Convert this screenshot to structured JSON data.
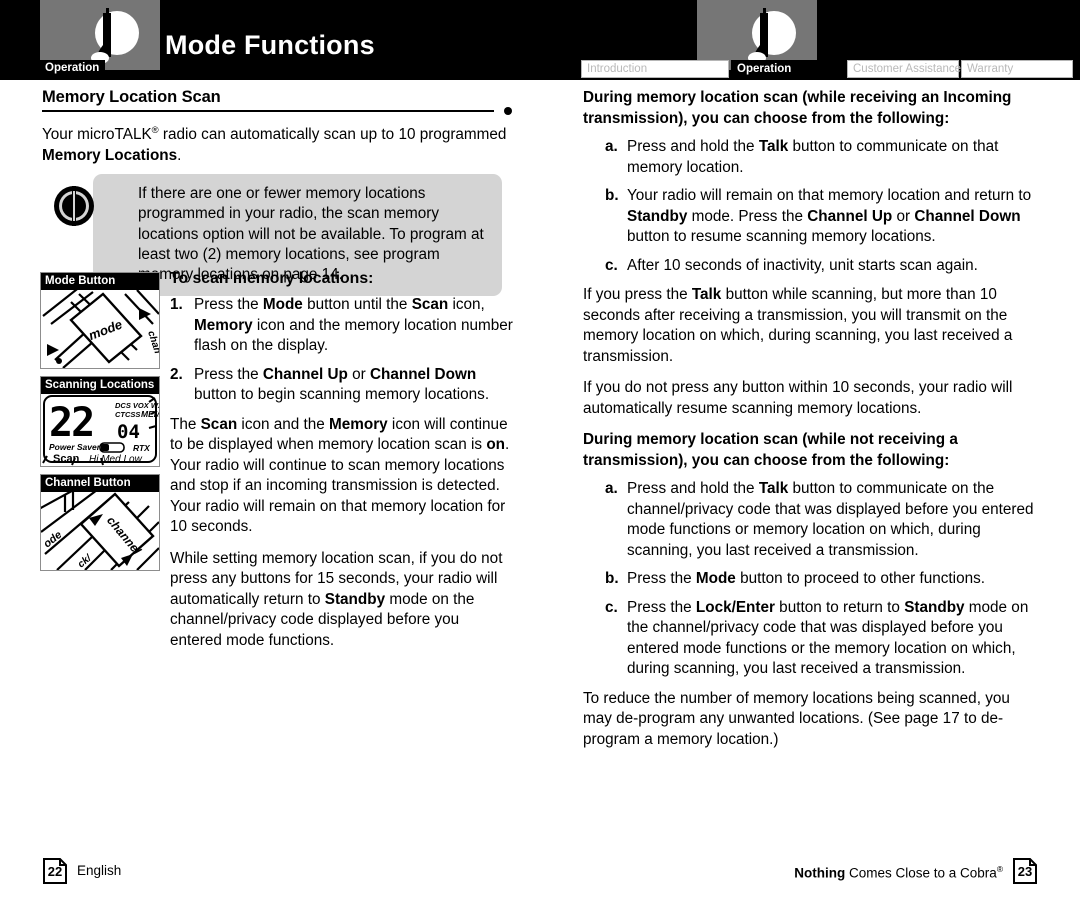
{
  "header": {
    "title": "Mode Functions",
    "operation_tag": "Operation",
    "logo_icon": "cobra-radio-logo-icon",
    "tabs": [
      {
        "label": "Introduction",
        "active": false
      },
      {
        "label": "Operation",
        "active": true
      },
      {
        "label": "Customer Assistance",
        "active": false
      },
      {
        "label": "Warranty",
        "active": false
      }
    ]
  },
  "left_page": {
    "section_heading": "Memory Location Scan",
    "intro_p1_a": "Your microTALK",
    "intro_p1_sup": "®",
    "intro_p1_b": " radio can automatically scan up to 10 programmed ",
    "intro_p1_bold": "Memory Locations",
    "intro_p1_c": ".",
    "note": {
      "icon": "info-circle-icon",
      "text": "If there are one or fewer memory locations programmed in your radio, the scan memory locations option will not be available. To program at least two (2) memory locations, see program memory locations on page 14."
    },
    "figures": [
      {
        "caption": "Mode Button",
        "art": "radio-mode-button-photo"
      },
      {
        "caption": "Scanning Locations",
        "art": "lcd-scanning-locations-photo"
      },
      {
        "caption": "Channel Button",
        "art": "radio-channel-button-photo"
      }
    ],
    "lcd": {
      "channel": "22",
      "memory": "04",
      "indicators": [
        "DCS",
        "VOX",
        "WX",
        "CTCSS",
        "MEM",
        "Power Saver",
        "RTX",
        "Scan",
        "Hi",
        "Med",
        "Low"
      ]
    },
    "sub_heading": "To scan memory locations:",
    "steps": [
      {
        "marker": "1.",
        "parts": [
          {
            "t": "Press the ",
            "b": false
          },
          {
            "t": "Mode",
            "b": true
          },
          {
            "t": " button until the ",
            "b": false
          },
          {
            "t": "Scan",
            "b": true
          },
          {
            "t": " icon, ",
            "b": false
          },
          {
            "t": "Memory",
            "b": true
          },
          {
            "t": " icon and the memory location number flash on the display.",
            "b": false
          }
        ]
      },
      {
        "marker": "2.",
        "parts": [
          {
            "t": "Press the ",
            "b": false
          },
          {
            "t": "Channel Up",
            "b": true
          },
          {
            "t": " or ",
            "b": false
          },
          {
            "t": "Channel Down",
            "b": true
          },
          {
            "t": " button to begin scanning memory locations.",
            "b": false
          }
        ]
      }
    ],
    "para_scan_on": [
      {
        "t": "The ",
        "b": false
      },
      {
        "t": "Scan",
        "b": true
      },
      {
        "t": " icon and the ",
        "b": false
      },
      {
        "t": "Memory",
        "b": true
      },
      {
        "t": " icon will continue to be displayed when memory location scan is ",
        "b": false
      },
      {
        "t": "on",
        "b": true
      },
      {
        "t": ". Your radio will continue to scan memory locations and stop if an incoming transmission is detected. Your radio will remain on that memory location for 10 seconds.",
        "b": false
      }
    ],
    "para_timeout": [
      {
        "t": "While setting memory location scan, if you do not press any buttons for 15 seconds, your radio will automatically return to ",
        "b": false
      },
      {
        "t": "Standby",
        "b": true
      },
      {
        "t": " mode on the channel/privacy code displayed before you entered mode functions.",
        "b": false
      }
    ]
  },
  "right_page": {
    "heading_receiving": "During memory location scan (while receiving an Incoming transmission), you can choose from the following:",
    "list_receiving": [
      {
        "marker": "a.",
        "parts": [
          {
            "t": "Press and hold the ",
            "b": false
          },
          {
            "t": "Talk",
            "b": true
          },
          {
            "t": " button to communicate on that memory location.",
            "b": false
          }
        ]
      },
      {
        "marker": "b.",
        "parts": [
          {
            "t": "Your radio will remain on that memory location and return to ",
            "b": false
          },
          {
            "t": "Standby",
            "b": true
          },
          {
            "t": " mode. Press the ",
            "b": false
          },
          {
            "t": "Channel Up",
            "b": true
          },
          {
            "t": " or ",
            "b": false
          },
          {
            "t": "Channel Down",
            "b": true
          },
          {
            "t": " button to resume scanning memory locations.",
            "b": false
          }
        ]
      },
      {
        "marker": "c.",
        "parts": [
          {
            "t": "After 10 seconds of inactivity, unit starts scan again.",
            "b": false
          }
        ]
      }
    ],
    "para_talk": [
      {
        "t": "If you press the ",
        "b": false
      },
      {
        "t": "Talk",
        "b": true
      },
      {
        "t": " button while scanning, but more than 10 seconds after receiving a transmission, you will transmit on the memory location on which, during scanning, you last received a transmission.",
        "b": false
      }
    ],
    "para_resume": [
      {
        "t": "If you do not press any button within 10 seconds, your radio will automatically resume scanning memory locations.",
        "b": false
      }
    ],
    "heading_not_receiving": "During memory location scan (while not receiving a transmission), you can choose from the following:",
    "list_not_receiving": [
      {
        "marker": "a.",
        "parts": [
          {
            "t": "Press and hold the ",
            "b": false
          },
          {
            "t": "Talk",
            "b": true
          },
          {
            "t": " button to communicate on the channel/privacy code that was displayed before you entered mode functions or memory location on which, during scanning, you last received a transmission.",
            "b": false
          }
        ]
      },
      {
        "marker": "b.",
        "parts": [
          {
            "t": "Press the ",
            "b": false
          },
          {
            "t": "Mode",
            "b": true
          },
          {
            "t": " button to proceed to other functions.",
            "b": false
          }
        ]
      },
      {
        "marker": "c.",
        "parts": [
          {
            "t": "Press the ",
            "b": false
          },
          {
            "t": "Lock/Enter",
            "b": true
          },
          {
            "t": " button to return to ",
            "b": false
          },
          {
            "t": "Standby",
            "b": true
          },
          {
            "t": " mode on the channel/privacy code that was displayed before you entered mode functions or the memory location on which, during scanning, you last received a transmission.",
            "b": false
          }
        ]
      }
    ],
    "para_reduce": [
      {
        "t": "To reduce the number of memory locations being scanned, you may de-program any unwanted locations. (See page 17 to de-program a memory location.)",
        "b": false
      }
    ]
  },
  "footer": {
    "left_page_number": "22",
    "left_label": "English",
    "right_tagline_bold": "Nothing",
    "right_tagline_rest": " Comes Close to a Cobra",
    "right_tagline_sup": "®",
    "right_page_number": "23"
  }
}
